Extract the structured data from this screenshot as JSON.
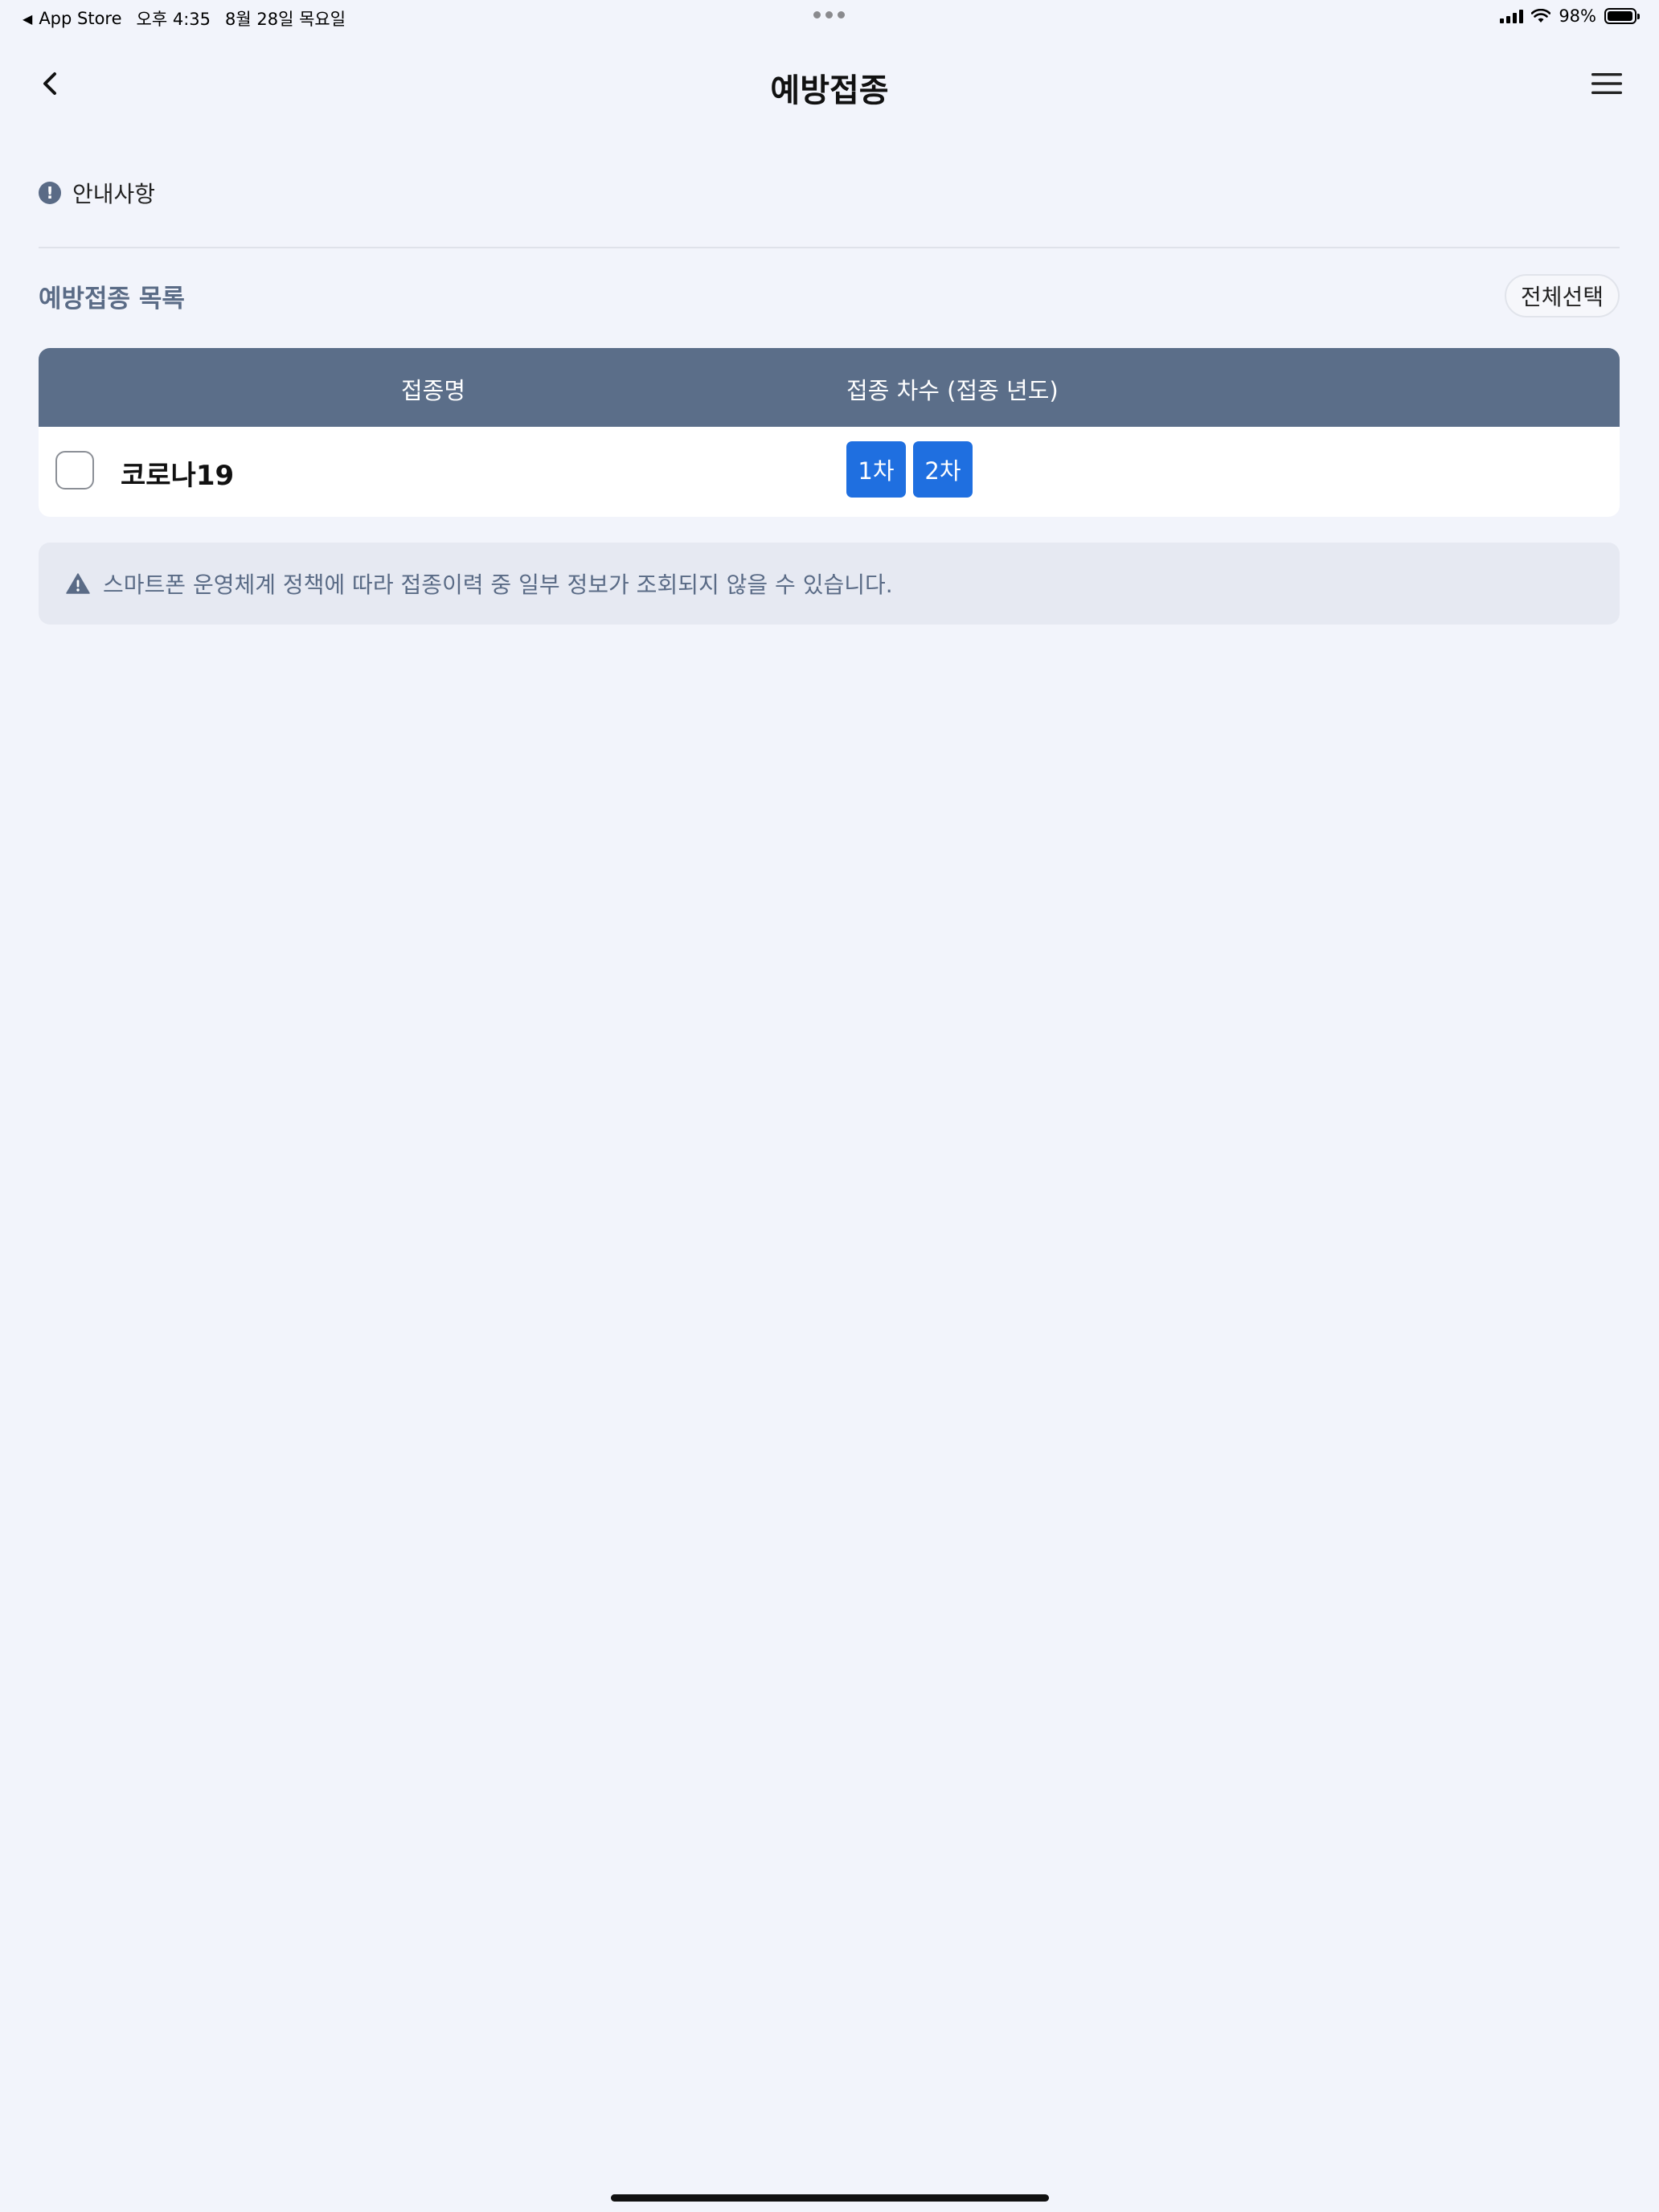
{
  "status_bar": {
    "back_app": "App Store",
    "time": "오후 4:35",
    "date": "8월 28일 목요일",
    "battery": "98%",
    "battery_level": 0.98
  },
  "header": {
    "title": "예방접종",
    "back_icon": "chevron-left-icon",
    "menu_icon": "hamburger-menu-icon"
  },
  "notice": {
    "icon": "info-icon",
    "label": "안내사항"
  },
  "list": {
    "title": "예방접종 목록",
    "select_all_label": "전체선택",
    "columns": {
      "name": "접종명",
      "dose": "접종 차수 (접종 년도)"
    },
    "rows": [
      {
        "name": "코로나19",
        "checked": false,
        "doses": [
          "1차",
          "2차"
        ]
      }
    ]
  },
  "warning": {
    "icon": "warning-icon",
    "text": "스마트폰 운영체계 정책에 따라 접종이력 중 일부 정보가 조회되지 않을 수 있습니다."
  },
  "colors": {
    "background": "#f2f4fb",
    "table_header": "#5b6e89",
    "dose_badge": "#1f6fe0",
    "muted_text": "#5a6b86",
    "warning_bg": "#e6e9f2"
  }
}
